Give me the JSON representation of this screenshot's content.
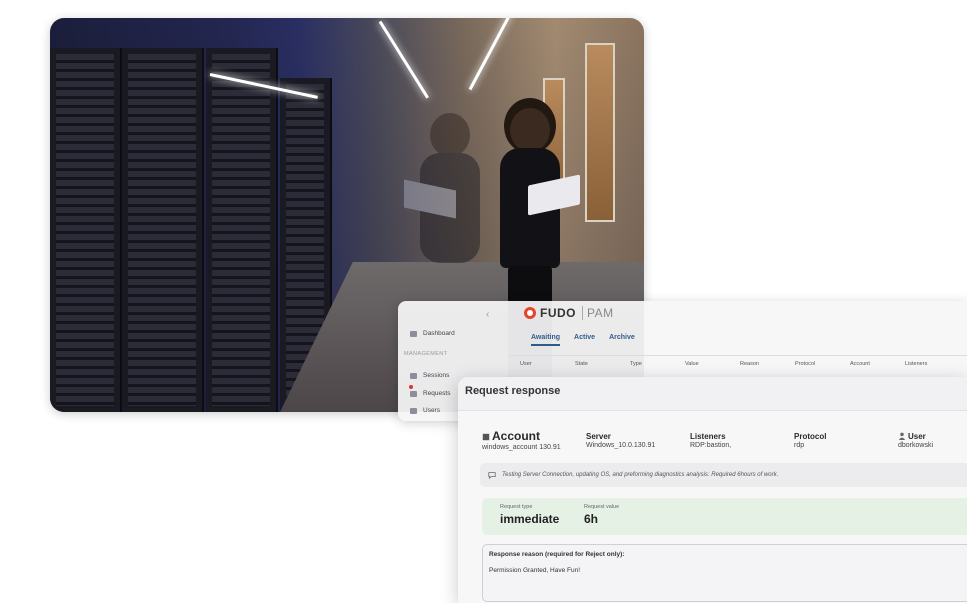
{
  "app": {
    "brand": "FUDO",
    "brand_suffix": "PAM",
    "sidebar": {
      "dashboard": "Dashboard",
      "section": "MANAGEMENT",
      "sessions": "Sessions",
      "requests": "Requests",
      "users": "Users"
    },
    "tabs": [
      "Awaiting",
      "Active",
      "Archive"
    ],
    "columns": [
      "User",
      "State",
      "Type",
      "Value",
      "Reason",
      "Protocol",
      "Account",
      "Listeners"
    ]
  },
  "modal": {
    "title": "Request response",
    "account": {
      "label": "Account",
      "value": "windows_account 130.91"
    },
    "server": {
      "label": "Server",
      "value": "Windows_10.0.130.91"
    },
    "listeners": {
      "label": "Listeners",
      "value": "RDP:bastion,"
    },
    "protocol": {
      "label": "Protocol",
      "value": "rdp"
    },
    "user": {
      "label": "User",
      "value": "dborkowski"
    },
    "note": "Testing Server Connection, updating OS, and preforming diagnostics analysis: Required 6hours of work.",
    "request_type": {
      "label": "Request type",
      "value": "immediate"
    },
    "request_value": {
      "label": "Request value",
      "value": "6h"
    },
    "response_reason": {
      "label": "Response reason (required for Reject only):",
      "value": "Permission Granted, Have Fun!"
    }
  },
  "colors": {
    "accent": "#2f5d8a",
    "brand": "#e3452a",
    "success_bg": "#e6f1e6"
  }
}
